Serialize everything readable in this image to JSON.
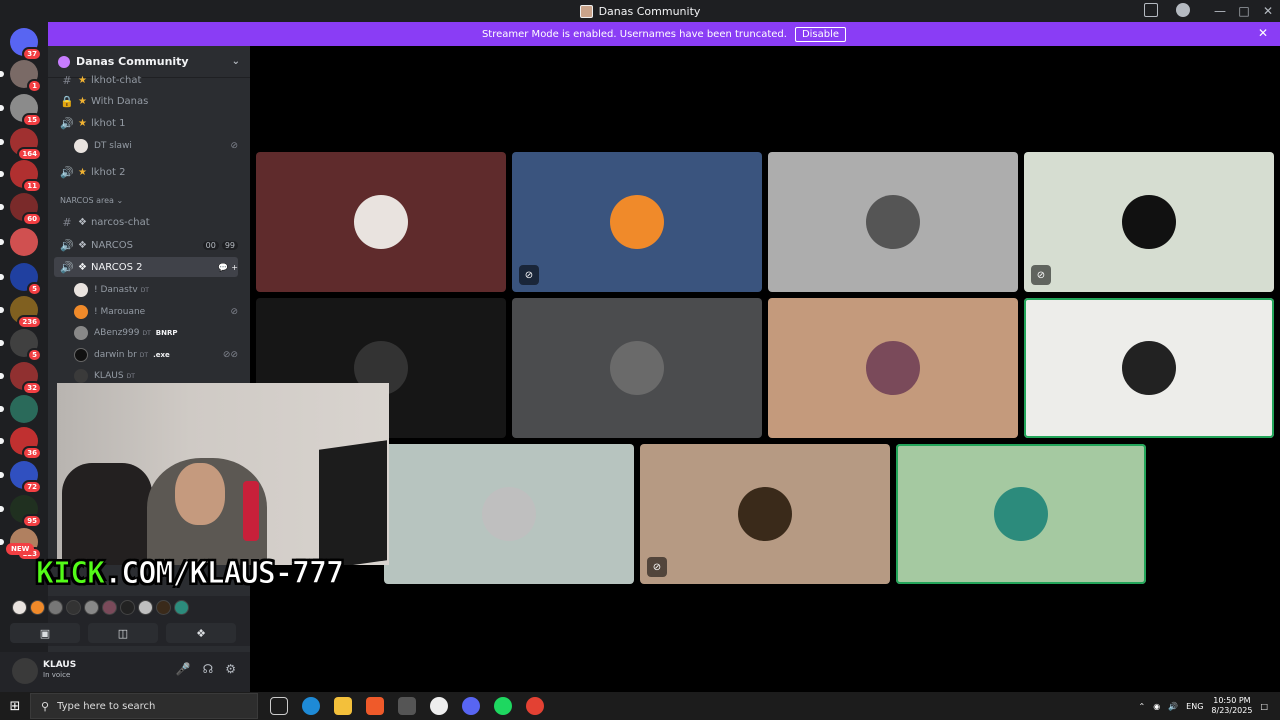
{
  "titlebar": {
    "title": "Danas Community"
  },
  "banner": {
    "text": "Streamer Mode is enabled. Usernames have been truncated.",
    "disable_label": "Disable"
  },
  "guilds": [
    {
      "badge": "37",
      "color": "#5865f2"
    },
    {
      "badge": "1",
      "color": "#7a6a66"
    },
    {
      "badge": "15",
      "color": "#8b8b8b"
    },
    {
      "badge": "164",
      "color": "#a03030"
    },
    {
      "badge": "11",
      "color": "#b03030"
    },
    {
      "badge": "60",
      "color": "#7a2a2a"
    },
    {
      "badge": "",
      "color": "#d05050"
    },
    {
      "badge": "5",
      "color": "#2040a0"
    },
    {
      "badge": "236",
      "color": "#806020"
    },
    {
      "badge": "5",
      "color": "#404040"
    },
    {
      "badge": "32",
      "color": "#903030"
    },
    {
      "badge": "",
      "color": "#2a6a5a"
    },
    {
      "badge": "36",
      "color": "#c03030"
    },
    {
      "badge": "72",
      "color": "#3050c0"
    },
    {
      "badge": "95",
      "color": "#203020"
    },
    {
      "badge": "123",
      "color": "#b08060"
    }
  ],
  "new_label": "NEW",
  "server": {
    "name": "Danas Community"
  },
  "channels": {
    "c1": "lkhot-chat",
    "c2": "With Danas",
    "c3": "lkhot 1",
    "c4": "lkhot 2",
    "category": "NARCOS area",
    "c5": "narcos-chat",
    "c6": "NARCOS",
    "c6_pill1": "00",
    "c6_pill2": "99",
    "c7": "NARCOS 2"
  },
  "users": {
    "u0": "DT slawi",
    "u1": "! Danastv",
    "u2": "! Marouane",
    "u3": "ABenz999",
    "u3_role": "BNRP",
    "u4": "darwin br",
    "u4_role": ".exe",
    "u5": "KLAUS",
    "dt_tag": "DT"
  },
  "overlay": {
    "kick_prefix": "KICK",
    "kick_rest": ".COM/KLAUS-777"
  },
  "self_user": {
    "name": "KLAUS",
    "status": "In voice"
  },
  "tiles": [
    {
      "bg": "#5f2b2c",
      "av": "#e9e3df",
      "mute": false,
      "speaking": false
    },
    {
      "bg": "#3a547e",
      "av": "#f08a2a",
      "mute": true,
      "speaking": false
    },
    {
      "bg": "#adadad",
      "av": "#555555",
      "mute": false,
      "speaking": false
    },
    {
      "bg": "#d6ddd1",
      "av": "#111111",
      "mute": true,
      "speaking": false
    },
    {
      "bg": "#161616",
      "av": "#333333",
      "mute": false,
      "speaking": false
    },
    {
      "bg": "#4b4c4e",
      "av": "#6a6a6a",
      "mute": false,
      "speaking": false
    },
    {
      "bg": "#c49a7c",
      "av": "#7a4a5a",
      "mute": false,
      "speaking": false
    },
    {
      "bg": "#ededea",
      "av": "#222222",
      "mute": false,
      "speaking": true
    },
    {
      "bg": "#b7c4bf",
      "av": "#bfbfbf",
      "mute": false,
      "speaking": false
    },
    {
      "bg": "#b69a83",
      "av": "#3a2a1a",
      "mute": true,
      "speaking": false
    },
    {
      "bg": "#a5c9a1",
      "av": "#2c8b7c",
      "mute": false,
      "speaking": true
    }
  ],
  "taskbar": {
    "search_placeholder": "Type here to search",
    "lang": "ENG",
    "time": "10:50 PM",
    "date": "8/23/2025"
  }
}
